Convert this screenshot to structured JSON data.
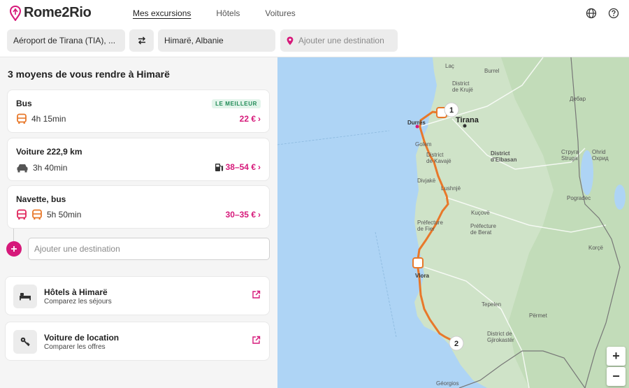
{
  "app": {
    "brand": "Rome2Rio"
  },
  "nav": {
    "trips": "Mes excursions",
    "hotels": "Hôtels",
    "cars": "Voitures"
  },
  "search": {
    "origin": "Aéroport de Tirana (TIA), ...",
    "destination": "Himarë, Albanie",
    "add_placeholder": "Ajouter une destination"
  },
  "results": {
    "title": "3 moyens de vous rendre à Himarë",
    "routes": [
      {
        "title": "Bus",
        "badge": "LE MEILLEUR",
        "duration": "4h 15min",
        "price": "22 €",
        "icons": [
          "bus-icon"
        ]
      },
      {
        "title": "Voiture 222,9 km",
        "duration": "3h 40min",
        "price": "38–54 €",
        "icons": [
          "car-icon",
          "fuel-icon"
        ]
      },
      {
        "title": "Navette, bus",
        "duration": "5h 50min",
        "price": "30–35 €",
        "icons": [
          "shuttle-icon",
          "bus-icon"
        ]
      }
    ],
    "add_destination": "Ajouter une destination"
  },
  "tiles": {
    "hotels": {
      "title": "Hôtels à Himarë",
      "subtitle": "Comparez les séjours"
    },
    "rental": {
      "title": "Voiture de location",
      "subtitle": "Comparer les offres"
    }
  },
  "map": {
    "labels": {
      "lac": "Laç",
      "burrel": "Burrel",
      "district_kruje": "District\nde Krujë",
      "durres": "Durrës",
      "tirana": "Tirana",
      "golem": "Golem",
      "district_kavaje": "District\nde Kavajë",
      "district_elbasan": "District\nd'Elbasan",
      "divjake": "Divjakë",
      "lushnje": "Lushnjë",
      "kucove": "Kuçovë",
      "prefecture_fier": "Préfecture\nde Fier",
      "prefecture_berat": "Préfecture\nde Berat",
      "vlora": "Vlora",
      "tepelen": "Tepelen",
      "permet": "Përmet",
      "district_gjirokaster": "District de\nGjirokastër",
      "struga": "Струга\nStruga",
      "ohrid": "Ohrid\nОхрид",
      "pogradec": "Pogradec",
      "korce": "Korçë",
      "bitola": "Дебар",
      "georgios": "Géorgios",
      "mavr": "Мавровски",
      "burrel_mk": "Burrel"
    },
    "markers": {
      "start": "1",
      "end": "2"
    },
    "zoom_in": "+",
    "zoom_out": "−"
  },
  "colors": {
    "accent": "#d6197a",
    "route": "#e8782a",
    "water": "#aed4f5",
    "land": "#cfe3c8"
  }
}
